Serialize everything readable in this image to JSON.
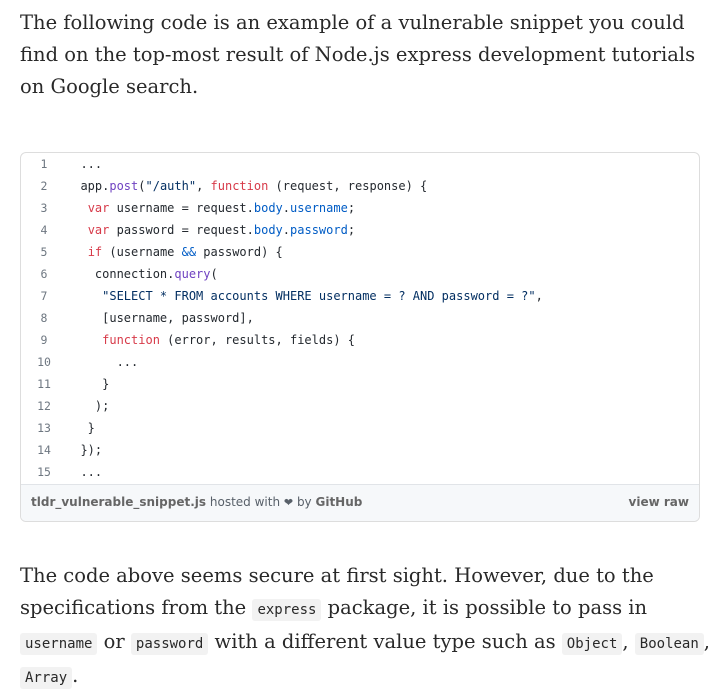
{
  "intro": {
    "text": "The following code is an example of a vulnerable snippet you could find on the top-most result of Node.js express development tutorials on Google search."
  },
  "gist": {
    "lines": [
      {
        "n": "1",
        "html": "  ..."
      },
      {
        "n": "2",
        "html": "  app.<span class=\"tok-fn\">post</span>(<span class=\"tok-str\">\"/auth\"</span>, <span class=\"tok-kw\">function</span> (request, response) {"
      },
      {
        "n": "3",
        "html": "   <span class=\"tok-kw\">var</span> username = request.<span class=\"tok-prop\">body</span>.<span class=\"tok-prop\">username</span>;"
      },
      {
        "n": "4",
        "html": "   <span class=\"tok-kw\">var</span> password = request.<span class=\"tok-prop\">body</span>.<span class=\"tok-prop\">password</span>;"
      },
      {
        "n": "5",
        "html": "   <span class=\"tok-kw\">if</span> (username <span class=\"tok-prop\">&amp;&amp;</span> password) {"
      },
      {
        "n": "6",
        "html": "    connection.<span class=\"tok-fn\">query</span>("
      },
      {
        "n": "7",
        "html": "     <span class=\"tok-str\">\"SELECT * FROM accounts WHERE username = ? AND password = ?\"</span>,"
      },
      {
        "n": "8",
        "html": "     [username, password],"
      },
      {
        "n": "9",
        "html": "     <span class=\"tok-kw\">function</span> (error, results, fields) {"
      },
      {
        "n": "10",
        "html": "       ..."
      },
      {
        "n": "11",
        "html": "     }"
      },
      {
        "n": "12",
        "html": "    );"
      },
      {
        "n": "13",
        "html": "   }"
      },
      {
        "n": "14",
        "html": "  });"
      },
      {
        "n": "15",
        "html": "  ..."
      }
    ],
    "filename": "tldr_vulnerable_snippet.js",
    "hosted_with": "hosted with",
    "heart": "❤",
    "by": "by",
    "host": "GitHub",
    "view_raw": "view raw"
  },
  "outro": {
    "text_1": "The code above seems secure at first sight. However, due to the specifications from the",
    "code_express": "express",
    "text_2": "package, it is possible to pass in",
    "code_username": "username",
    "text_3": "or",
    "code_password": "password",
    "text_4": "with a different value type such as",
    "code_object": "Object",
    "code_boolean": "Boolean",
    "code_array": "Array",
    "text_5": "."
  }
}
